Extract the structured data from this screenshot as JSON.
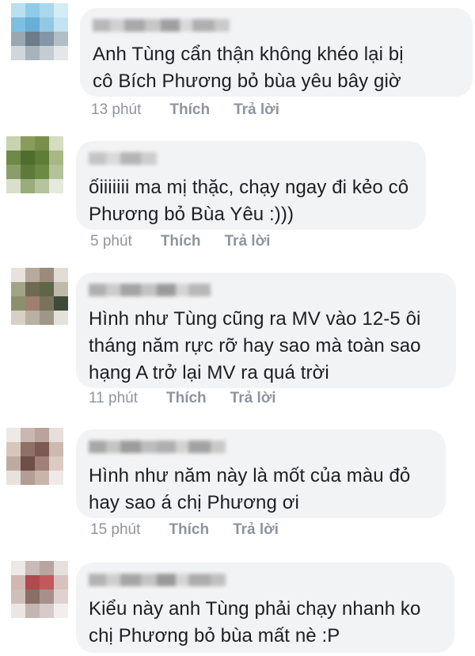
{
  "comments": [
    {
      "text": "Anh Tùng cẩn thận không khéo lại bị\ncô Bích Phương bỏ bùa yêu bây giờ",
      "time": "13 phút",
      "like": "Thích",
      "reply": "Trả lời",
      "avatar_colors": [
        "#b9dff0",
        "#8fcbe8",
        "#a9d7ee",
        "#d5ecf5",
        "#7dbfe0",
        "#6aaed6",
        "#93c8e4",
        "#c3e3f2",
        "#9aa7b3",
        "#6d7c8a",
        "#8497a8",
        "#b2bdc6",
        "#cfd6dc",
        "#a8b2ba",
        "#c5ccd2",
        "#e3e7ea"
      ],
      "name_colors": [
        "#b8b8b8",
        "#d0d0d0",
        "#a9a9a9",
        "#c6c6c6",
        "#9f9f9f",
        "#d9d9d9",
        "#b0b0b0",
        "#cacaca"
      ]
    },
    {
      "text": "ốiiiiiii ma mị thặc, chạy ngay đi kẻo cô\nPhương bỏ Bùa Yêu :)))",
      "time": "5 phút",
      "like": "Thích",
      "reply": "Trả lời",
      "avatar_colors": [
        "#c9d3b0",
        "#8a9c5c",
        "#7a8f4c",
        "#d5dcc0",
        "#6f8a44",
        "#4f6e2e",
        "#5e7d39",
        "#a7b884",
        "#8b9d6a",
        "#5d7a3a",
        "#6c8a45",
        "#b4c29a",
        "#d9dfca",
        "#9aab7c",
        "#b6c39e",
        "#e6eadc"
      ],
      "name_colors": [
        "#c4c4c4",
        "#dadada",
        "#b5b5b5",
        "#cdcdcd"
      ]
    },
    {
      "text": "Hình như Tùng cũng ra MV vào 12-5 ôi\ntháng năm rực rỡ hay sao mà toàn sao\nhạng A trở lại MV ra quá trời",
      "time": "11 phút",
      "like": "Thích",
      "reply": "Trả lời",
      "avatar_colors": [
        "#e8e2dc",
        "#b7a99c",
        "#9c8b7c",
        "#e2dcd6",
        "#a1a487",
        "#6f6a52",
        "#5c6748",
        "#c0b9a8",
        "#8c8f6c",
        "#a07f6e",
        "#7a735a",
        "#3f4a38",
        "#d6d0c6",
        "#b8b0a2",
        "#9e9788",
        "#e4e0da"
      ],
      "name_colors": [
        "#b0b0b0",
        "#cccccc",
        "#a4a4a4",
        "#c2c2c2",
        "#9a9a9a",
        "#d4d4d4",
        "#b8b8b8"
      ]
    },
    {
      "text": "Hình như năm này là mốt của màu đỏ\nhay sao á chị Phương ơi",
      "time": "15 phút",
      "like": "Thích",
      "reply": "Trả lời",
      "avatar_colors": [
        "#eee9e6",
        "#c9b7b0",
        "#b9a39a",
        "#e6dfdb",
        "#d8c6bd",
        "#8f6f66",
        "#7c5a52",
        "#cdb9b0",
        "#bfaaa1",
        "#6e4e48",
        "#a08078",
        "#dccbc3",
        "#e8e2de",
        "#b39d95",
        "#c8b4ab",
        "#efeae7"
      ],
      "name_colors": [
        "#a7a7a7",
        "#c5c5c5",
        "#9c9c9c",
        "#bdbdbd",
        "#afafaf",
        "#d2d2d2",
        "#a2a2a2",
        "#c9c9c9"
      ]
    },
    {
      "text": "Kiểu này anh Tùng phải chạy nhanh ko\nchị Phương bỏ bùa mất nè :P",
      "time": "",
      "like": "",
      "reply": "",
      "avatar_colors": [
        "#ece8e6",
        "#c8bab6",
        "#b8a5a0",
        "#e6e0dd",
        "#d2b6b2",
        "#b04a4e",
        "#c2585c",
        "#d8c2be",
        "#cdbfba",
        "#8a6e69",
        "#a6908b",
        "#ddd2cf",
        "#ebe6e4",
        "#c3b5b1",
        "#d6cbc8",
        "#f1eeec"
      ],
      "name_colors": [
        "#b3b3b3",
        "#cfcfcf",
        "#a6a6a6",
        "#c4c4c4",
        "#999999",
        "#d5d5d5",
        "#adadad",
        "#c0c0c0"
      ]
    }
  ]
}
